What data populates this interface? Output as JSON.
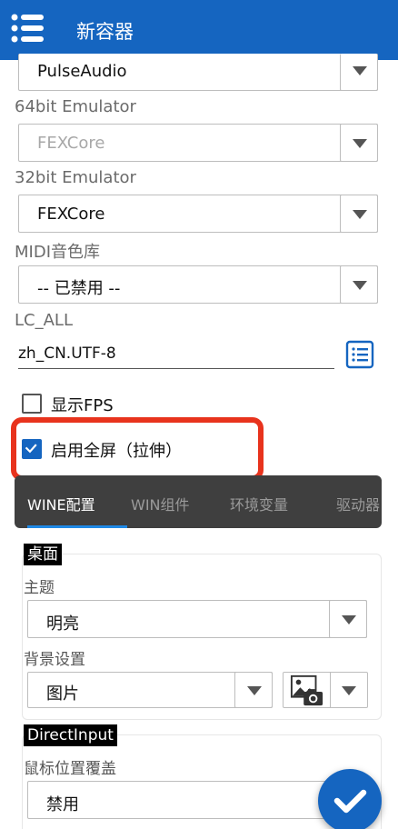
{
  "appbar": {
    "title": "新容器",
    "menu_icon": "hamburger-menu-icon"
  },
  "audio": {
    "selected": "PulseAudio"
  },
  "emu64": {
    "label": "64bit Emulator",
    "selected": "FEXCore"
  },
  "emu32": {
    "label": "32bit Emulator",
    "selected": "FEXCore"
  },
  "midi": {
    "label": "MIDI音色库",
    "selected": "-- 已禁用 --"
  },
  "lc_all": {
    "label": "LC_ALL",
    "value": "zh_CN.UTF-8",
    "list_icon": "list-icon"
  },
  "options": {
    "show_fps": {
      "label": "显示FPS",
      "checked": false
    },
    "fullscreen": {
      "label": "启用全屏（拉伸）",
      "checked": true
    }
  },
  "tabs": [
    {
      "label": "WINE配置",
      "active": true
    },
    {
      "label": "WIN组件",
      "active": false
    },
    {
      "label": "环境变量",
      "active": false
    },
    {
      "label": "驱动器",
      "active": false
    }
  ],
  "desktop": {
    "title": "桌面",
    "theme_label": "主题",
    "theme_value": "明亮",
    "bg_label": "背景设置",
    "bg_value": "图片",
    "image_icon": "image-picker-icon"
  },
  "directinput": {
    "title": "DirectInput",
    "mouse_label": "鼠标位置覆盖",
    "mouse_value": "禁用"
  },
  "fab": {
    "icon": "checkmark-icon"
  },
  "colors": {
    "primary": "#1565c0",
    "highlight": "#e8331d",
    "tabbar": "#3f3f3f"
  }
}
